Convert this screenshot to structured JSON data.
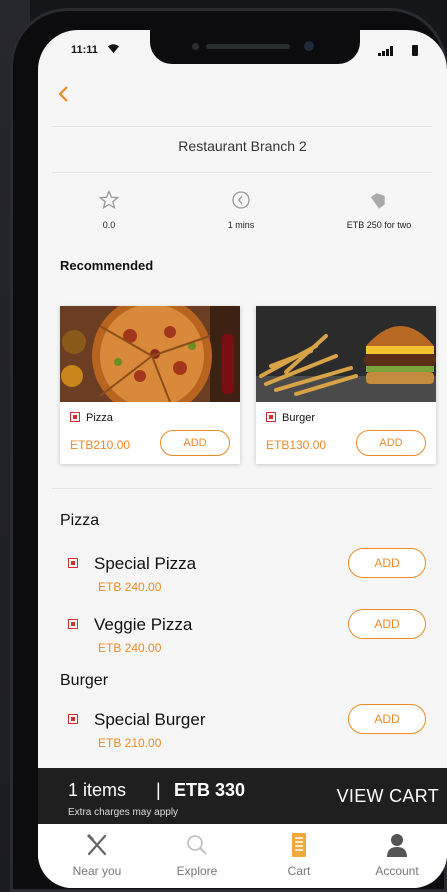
{
  "status_bar": {
    "time": "11:11"
  },
  "restaurant": {
    "name": "Restaurant Branch 2"
  },
  "info": [
    {
      "icon": "star-icon",
      "value": "0.0"
    },
    {
      "icon": "clock-icon",
      "value": "1 mins"
    },
    {
      "icon": "tag-icon",
      "value": "ETB 250 for two"
    }
  ],
  "recommended": {
    "heading": "Recommended",
    "items": [
      {
        "name": "Pizza",
        "price": "ETB210.00",
        "add_label": "ADD"
      },
      {
        "name": "Burger",
        "price": "ETB130.00",
        "add_label": "ADD"
      }
    ]
  },
  "menu": [
    {
      "category": "Pizza",
      "items": [
        {
          "name": "Special Pizza",
          "price": "ETB 240.00",
          "add_label": "ADD"
        },
        {
          "name": "Veggie Pizza",
          "price": "ETB 240.00",
          "add_label": "ADD"
        }
      ]
    },
    {
      "category": "Burger",
      "items": [
        {
          "name": "Special Burger",
          "price": "ETB 210.00",
          "add_label": "ADD"
        }
      ]
    }
  ],
  "cart_bar": {
    "items_count": "1 items",
    "separator": "|",
    "total": "ETB 330",
    "note": "Extra charges may apply",
    "view_label": "VIEW CART"
  },
  "tabs": [
    {
      "label": "Near you",
      "icon": "fork-knife-icon"
    },
    {
      "label": "Explore",
      "icon": "search-icon"
    },
    {
      "label": "Cart",
      "icon": "receipt-icon",
      "active": true
    },
    {
      "label": "Account",
      "icon": "user-icon"
    }
  ],
  "colors": {
    "accent": "#f08a24",
    "veg_marker": "#d32f2f",
    "cart_bar": "#1f1f1f"
  }
}
